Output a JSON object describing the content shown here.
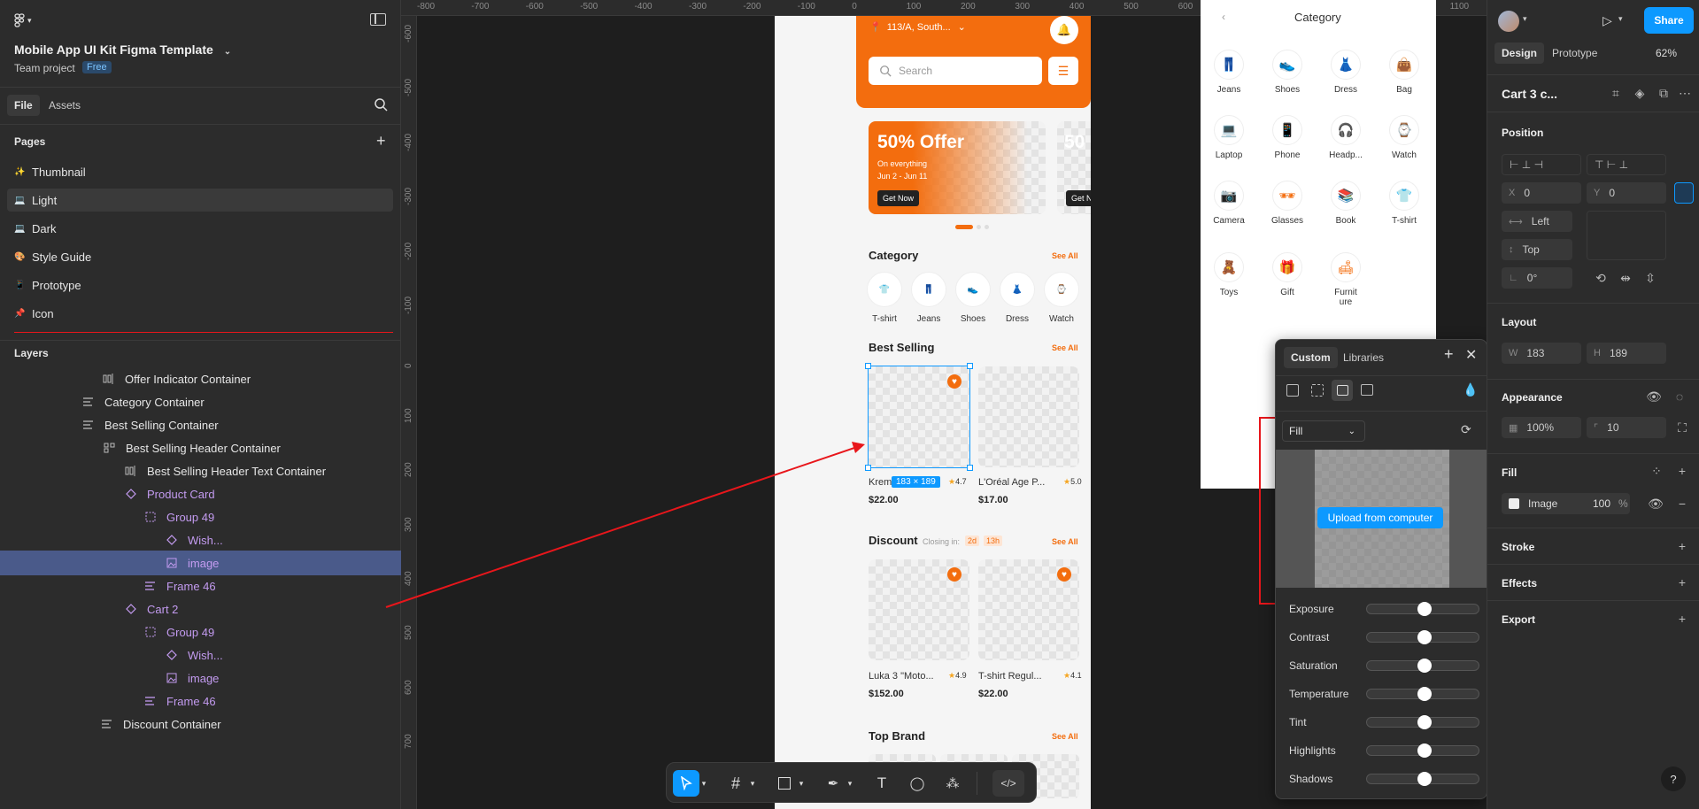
{
  "app": {
    "file_name": "Mobile App UI Kit Figma Template",
    "team_label": "Team project",
    "plan_badge": "Free",
    "tabs": [
      "File",
      "Assets"
    ],
    "pages_title": "Pages",
    "layers_title": "Layers"
  },
  "pages": [
    {
      "icon": "✨",
      "label": "Thumbnail"
    },
    {
      "icon": "💻",
      "label": "Light",
      "selected": true
    },
    {
      "icon": "💻",
      "label": "Dark"
    },
    {
      "icon": "🎨",
      "label": "Style Guide"
    },
    {
      "icon": "📱",
      "label": "Prototype"
    },
    {
      "icon": "📌",
      "label": "Icon"
    }
  ],
  "layers": [
    {
      "label": "Offer Indicator Container",
      "indent": 1,
      "icon": "auto-layout-h"
    },
    {
      "label": "Category Container",
      "indent": 0,
      "icon": "auto-layout-v"
    },
    {
      "label": "Best Selling Container",
      "indent": 0,
      "icon": "auto-layout-v"
    },
    {
      "label": "Best Selling Header Container",
      "indent": 1,
      "icon": "auto-layout-grid"
    },
    {
      "label": "Best Selling Header Text Container",
      "indent": 2,
      "icon": "auto-layout-h"
    },
    {
      "label": "Product Card",
      "indent": 1,
      "icon": "component",
      "purple": true
    },
    {
      "label": "Group 49",
      "indent": 2,
      "icon": "group",
      "purple": true
    },
    {
      "label": "Wish...",
      "indent": 3,
      "icon": "instance",
      "purple": true
    },
    {
      "label": "image",
      "indent": 3,
      "icon": "image",
      "purple": true,
      "selected": true
    },
    {
      "label": "Frame 46",
      "indent": 2,
      "icon": "auto-layout-v",
      "purple": true
    },
    {
      "label": "Cart 2",
      "indent": 1,
      "icon": "component",
      "purple": true
    },
    {
      "label": "Group 49",
      "indent": 2,
      "icon": "group",
      "purple": true
    },
    {
      "label": "Wish...",
      "indent": 3,
      "icon": "instance",
      "purple": true
    },
    {
      "label": "image",
      "indent": 3,
      "icon": "image",
      "purple": true
    },
    {
      "label": "Frame 46",
      "indent": 2,
      "icon": "auto-layout-v",
      "purple": true
    },
    {
      "label": "Discount Container",
      "indent": 0,
      "icon": "auto-layout-v"
    }
  ],
  "ruler": {
    "top": [
      "-800",
      "-700",
      "-600",
      "-500",
      "-400",
      "-300",
      "-200",
      "-100",
      "0",
      "100",
      "200",
      "300",
      "400",
      "500",
      "600",
      "700",
      "800",
      "900",
      "1000",
      "1100"
    ],
    "left": [
      "-600",
      "-500",
      "-400",
      "-300",
      "-200",
      "-100",
      "0",
      "100",
      "200",
      "300",
      "400",
      "500",
      "600",
      "700"
    ]
  },
  "phone": {
    "location": "113/A, South...",
    "search_placeholder": "Search",
    "offer_title": "50% Offer",
    "offer_sub": "On everything",
    "offer_dates": "Jun 2 - Jun 11",
    "offer_button": "Get Now",
    "offer_button2": "Get N",
    "offer_title2": "50",
    "category_title": "Category",
    "see_all": "See All",
    "categories": [
      "T-shirt",
      "Jeans",
      "Shoes",
      "Dress",
      "Watch"
    ],
    "best_selling_title": "Best Selling",
    "selection_size": "183 × 189",
    "best_selling": [
      {
        "title": "Krem",
        "price": "$22.00",
        "rating": "4.7"
      },
      {
        "title": "L'Oréal Age P...",
        "price": "$17.00",
        "rating": "5.0"
      }
    ],
    "discount_title": "Discount",
    "closing_label": "Closing in:",
    "closing_days": "2d",
    "closing_hours": "13h",
    "discount": [
      {
        "title": "Luka 3 \"Moto...",
        "price": "$152.00",
        "rating": "4.9"
      },
      {
        "title": "T-shirt Regul...",
        "price": "$22.00",
        "rating": "4.1"
      }
    ],
    "top_brand_title": "Top Brand"
  },
  "category_frame": {
    "title": "Category",
    "items": [
      "Jeans",
      "Shoes",
      "Dress",
      "Bag",
      "Laptop",
      "Phone",
      "Headp...",
      "Watch",
      "Camera",
      "Glasses",
      "Book",
      "T-shirt",
      "Toys",
      "Gift",
      "Furnit\nure"
    ]
  },
  "popup": {
    "tabs": [
      "Custom",
      "Libraries"
    ],
    "fill_type": "Fill",
    "upload_button": "Upload from computer",
    "adjustments": [
      "Exposure",
      "Contrast",
      "Saturation",
      "Temperature",
      "Tint",
      "Highlights",
      "Shadows"
    ]
  },
  "right": {
    "tabs": [
      "Design",
      "Prototype"
    ],
    "zoom": "62%",
    "share": "Share",
    "layer_name": "Cart 3 c...",
    "position_title": "Position",
    "x_label": "X",
    "x_value": "0",
    "y_label": "Y",
    "y_value": "0",
    "h_constraint": "Left",
    "v_constraint": "Top",
    "rotation": "0°",
    "layout_title": "Layout",
    "w_label": "W",
    "w_value": "183",
    "h_label": "H",
    "h_value": "189",
    "appearance_title": "Appearance",
    "opacity": "100%",
    "radius": "10",
    "fill_title": "Fill",
    "fill_type": "Image",
    "fill_opacity": "100",
    "fill_percent": "%",
    "stroke_title": "Stroke",
    "effects_title": "Effects",
    "export_title": "Export"
  },
  "colors": {
    "accent": "#f36d0e",
    "figma_blue": "#0d99ff",
    "annotation_red": "#e8161b"
  }
}
